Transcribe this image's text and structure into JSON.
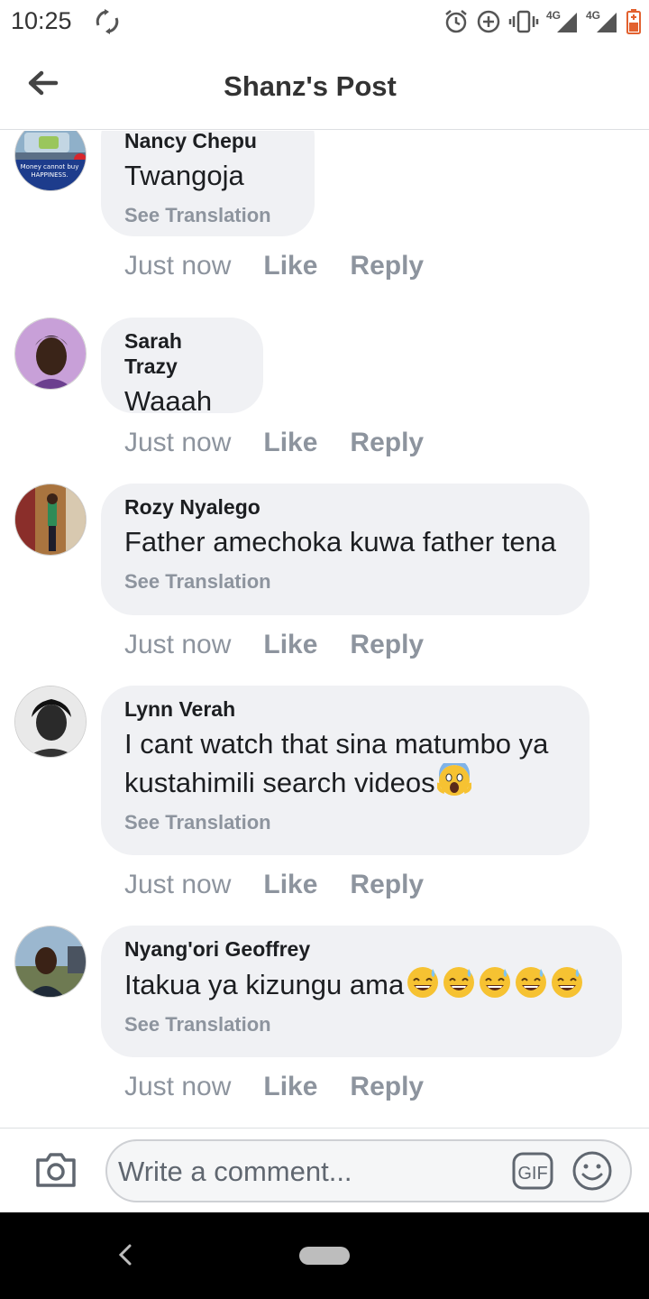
{
  "status_bar": {
    "time": "10:25",
    "network_1": "4G",
    "network_2": "4G"
  },
  "header": {
    "title": "Shanz's Post"
  },
  "comments": [
    {
      "name": "Nancy Chepu",
      "text": "Twangoja",
      "translation": "See Translation",
      "avatar_caption_1": "Money cannot buy",
      "avatar_caption_2": "HAPPINESS.",
      "time": "Just now",
      "like": "Like",
      "reply": "Reply"
    },
    {
      "name": "Sarah Trazy",
      "text": "Waaah",
      "time": "Just now",
      "like": "Like",
      "reply": "Reply"
    },
    {
      "name": "Rozy Nyalego",
      "text": "Father amechoka kuwa father tena",
      "translation": "See Translation",
      "time": "Just now",
      "like": "Like",
      "reply": "Reply"
    },
    {
      "name": "Lynn Verah",
      "text_line1": "I cant watch that sina matumbo ya",
      "text_line2": "kustahimili search videos",
      "translation": "See Translation",
      "time": "Just now",
      "like": "Like",
      "reply": "Reply"
    },
    {
      "name": "Nyang'ori Geoffrey",
      "text": "Itakua ya kizungu ama",
      "translation": "See Translation",
      "time": "Just now",
      "like": "Like",
      "reply": "Reply"
    }
  ],
  "composer": {
    "placeholder": "Write a comment...",
    "gif_label": "GIF"
  },
  "colors": {
    "bubble": "#f0f1f4",
    "meta_text": "#8d949e",
    "title_text": "#333333"
  }
}
